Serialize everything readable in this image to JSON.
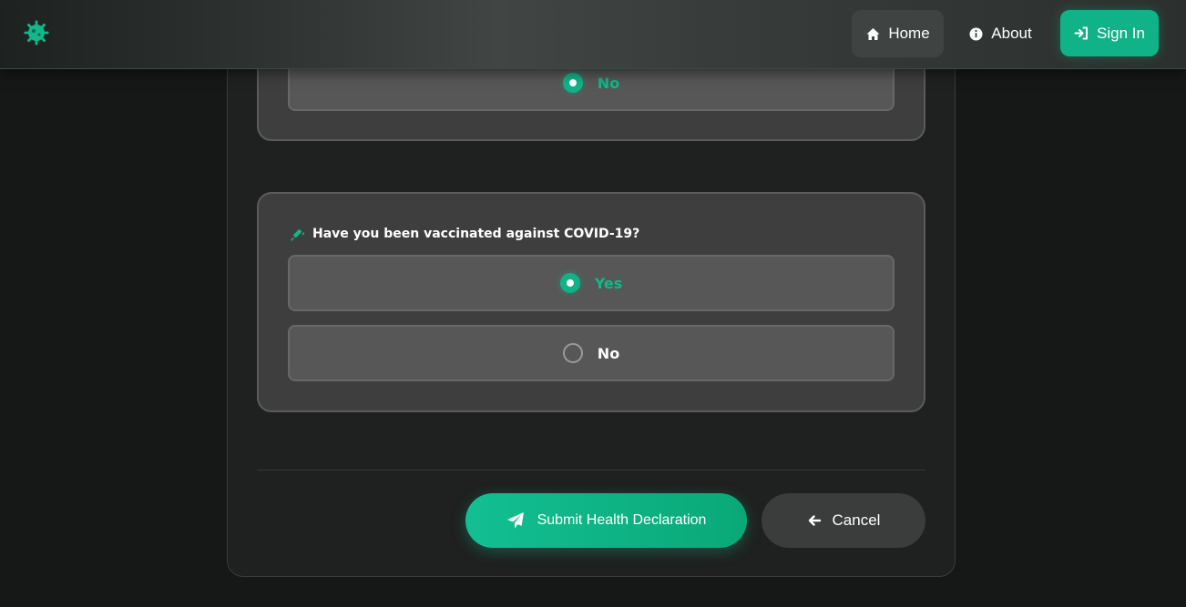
{
  "navbar": {
    "home_label": "Home",
    "about_label": "About",
    "signin_label": "Sign In"
  },
  "question_previous": {
    "options": [
      {
        "label": "No",
        "selected": true
      }
    ]
  },
  "question_vaccine": {
    "label": "Have you been vaccinated against COVID-19?",
    "options": [
      {
        "label": "Yes",
        "selected": true
      },
      {
        "label": "No",
        "selected": false
      }
    ]
  },
  "actions": {
    "submit_label": "Submit Health Declaration",
    "cancel_label": "Cancel"
  },
  "colors": {
    "accent": "#10b387",
    "background": "#161717",
    "card": "#3e3e3e"
  },
  "icons": {
    "logo": "virus-icon",
    "home": "home-icon",
    "about": "info-icon",
    "signin": "sign-in-icon",
    "question": "syringe-icon",
    "submit": "paper-plane-icon",
    "cancel": "arrow-left-icon"
  }
}
